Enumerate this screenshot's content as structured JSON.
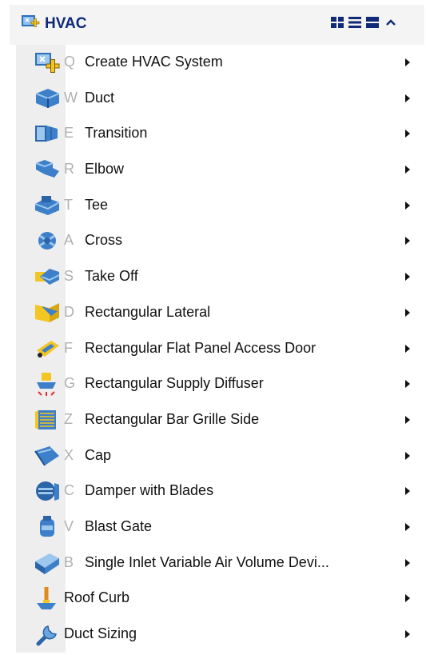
{
  "panel": {
    "title": "HVAC",
    "header_icon": "hvac-system-icon",
    "controls": [
      "grid-view-icon",
      "list-view-icon",
      "large-list-view-icon",
      "collapse-chevron-icon"
    ]
  },
  "menu": {
    "items": [
      {
        "key": "Q",
        "label": "Create HVAC System",
        "icon": "create-hvac-system-icon"
      },
      {
        "key": "W",
        "label": "Duct",
        "icon": "duct-icon"
      },
      {
        "key": "E",
        "label": "Transition",
        "icon": "transition-icon"
      },
      {
        "key": "R",
        "label": "Elbow",
        "icon": "elbow-icon"
      },
      {
        "key": "T",
        "label": "Tee",
        "icon": "tee-icon"
      },
      {
        "key": "A",
        "label": "Cross",
        "icon": "cross-icon"
      },
      {
        "key": "S",
        "label": "Take Off",
        "icon": "take-off-icon"
      },
      {
        "key": "D",
        "label": "Rectangular Lateral",
        "icon": "rectangular-lateral-icon"
      },
      {
        "key": "F",
        "label": "Rectangular Flat Panel Access Door",
        "icon": "access-door-icon"
      },
      {
        "key": "G",
        "label": "Rectangular Supply Diffuser",
        "icon": "supply-diffuser-icon"
      },
      {
        "key": "Z",
        "label": "Rectangular Bar Grille Side",
        "icon": "bar-grille-icon"
      },
      {
        "key": "X",
        "label": "Cap",
        "icon": "cap-icon"
      },
      {
        "key": "C",
        "label": "Damper with Blades",
        "icon": "damper-icon"
      },
      {
        "key": "V",
        "label": "Blast Gate",
        "icon": "blast-gate-icon"
      },
      {
        "key": "B",
        "label": "Single Inlet Variable Air Volume Devi...",
        "icon": "vav-device-icon"
      },
      {
        "key": "",
        "label": "Roof Curb",
        "icon": "roof-curb-icon"
      },
      {
        "key": "",
        "label": "Duct Sizing",
        "icon": "duct-sizing-icon"
      }
    ]
  },
  "colors": {
    "title": "#0f2a78",
    "icon_blue": "#2f6fb8",
    "icon_yellow": "#f3c623",
    "key_gray": "#b0b0b0"
  }
}
